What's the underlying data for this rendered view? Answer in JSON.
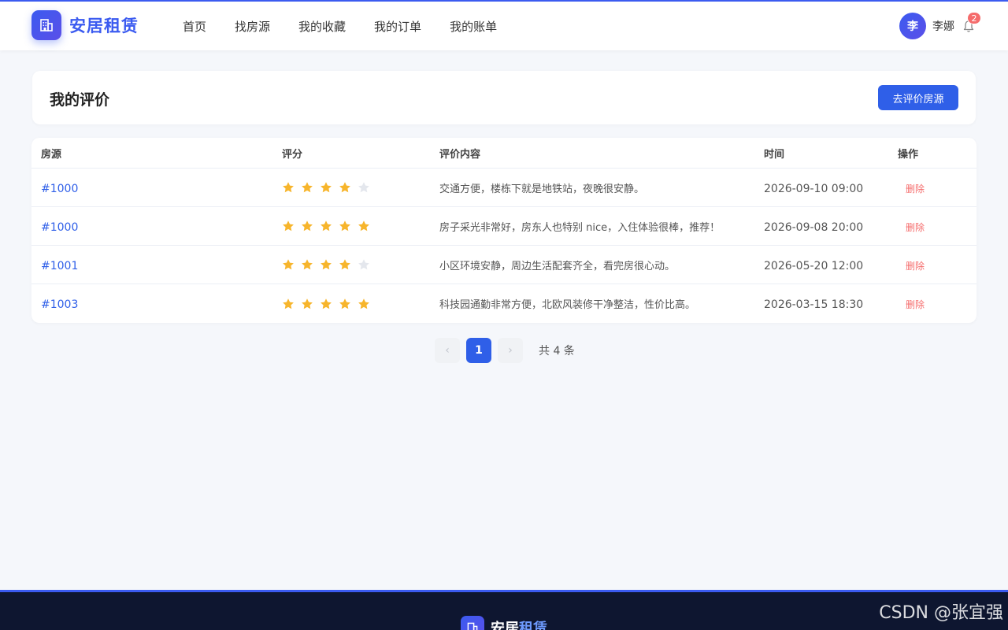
{
  "app": {
    "name": "安居租赁",
    "footer_name_a": "安居",
    "footer_name_b": "租赁"
  },
  "nav": {
    "items": [
      {
        "label": "首页"
      },
      {
        "label": "找房源"
      },
      {
        "label": "我的收藏"
      },
      {
        "label": "我的订单"
      },
      {
        "label": "我的账单"
      }
    ]
  },
  "user": {
    "avatar_char": "李",
    "name": "李娜",
    "notification_count": "2"
  },
  "page": {
    "title": "我的评价",
    "action_label": "去评价房源"
  },
  "table": {
    "headers": {
      "house": "房源",
      "rating": "评分",
      "content": "评价内容",
      "time": "时间",
      "action": "操作"
    },
    "rows": [
      {
        "house": "#1000",
        "rating": 4,
        "content": "交通方便，楼栋下就是地铁站，夜晚很安静。",
        "time": "2026-09-10 09:00",
        "action": "删除"
      },
      {
        "house": "#1000",
        "rating": 5,
        "content": "房子采光非常好，房东人也特别 nice，入住体验很棒，推荐！",
        "time": "2026-09-08 20:00",
        "action": "删除"
      },
      {
        "house": "#1001",
        "rating": 4,
        "content": "小区环境安静，周边生活配套齐全，看完房很心动。",
        "time": "2026-05-20 12:00",
        "action": "删除"
      },
      {
        "house": "#1003",
        "rating": 5,
        "content": "科技园通勤非常方便，北欧风装修干净整洁，性价比高。",
        "time": "2026-03-15 18:30",
        "action": "删除"
      }
    ]
  },
  "pagination": {
    "prev_icon": "‹",
    "next_icon": "›",
    "current_page": "1",
    "total_text": "共 4 条"
  },
  "watermark": "CSDN @张宜强",
  "colors": {
    "primary": "#2f5fe8",
    "star_on": "#f7b52c",
    "star_off": "#e4e7ed",
    "danger": "#f56c6c"
  },
  "icons": {
    "logo": "building-icon",
    "bell": "bell-icon",
    "star": "star-icon"
  }
}
